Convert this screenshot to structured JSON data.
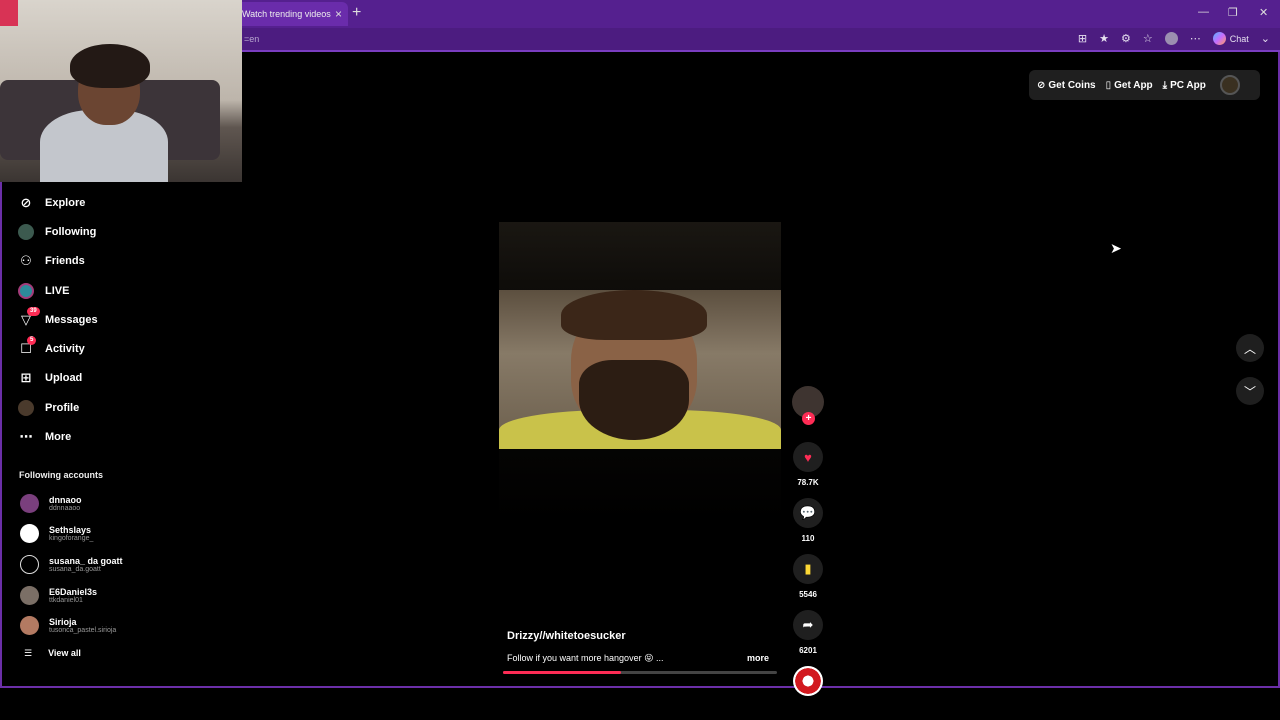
{
  "browser": {
    "tab_title": "Watch trending videos for",
    "new_tab": "+",
    "address_fragment": "=en",
    "chat_label": "Chat",
    "window_controls": [
      "—",
      "❐",
      "✕"
    ]
  },
  "header": {
    "get_coins": "Get Coins",
    "get_app": "Get App",
    "pc_app": "PC App"
  },
  "sidebar": {
    "items": [
      {
        "label": "Explore",
        "icon": "compass-icon"
      },
      {
        "label": "Following",
        "icon": "avatar-icon"
      },
      {
        "label": "Friends",
        "icon": "people-icon"
      },
      {
        "label": "LIVE",
        "icon": "live-icon"
      },
      {
        "label": "Messages",
        "icon": "send-icon",
        "badge": "39"
      },
      {
        "label": "Activity",
        "icon": "bell-message-icon",
        "badge": "5"
      },
      {
        "label": "Upload",
        "icon": "plus-square-icon"
      },
      {
        "label": "Profile",
        "icon": "profile-avatar-icon"
      },
      {
        "label": "More",
        "icon": "ellipsis-icon"
      }
    ],
    "following_title": "Following accounts",
    "accounts": [
      {
        "name": "dnnaoo",
        "handle": "ddnnaaoo",
        "color": "#7a3f7d"
      },
      {
        "name": "Sethslays",
        "handle": "kingoforange_",
        "color": "#ffffff"
      },
      {
        "name": "susana_ da goatt",
        "handle": "susana_da.goatt",
        "color": "#000000"
      },
      {
        "name": "E6Daniel3s",
        "handle": "ttkdaniel01",
        "color": "#7b6f66"
      },
      {
        "name": "Sirioja",
        "handle": "tusonca_pastel.sirioja",
        "color": "#b37a62"
      }
    ],
    "view_all": "View all"
  },
  "video": {
    "author": "Drizzy//whitetoesucker",
    "caption": "Follow if you want more hangover 😝 ...",
    "more": "more",
    "progress": 0.43,
    "likes": "78.7K",
    "comments": "110",
    "saves": "5546",
    "shares": "6201"
  },
  "colors": {
    "accent": "#fe2c55",
    "browser_purple": "#55208f",
    "save_yellow": "#fdd835"
  }
}
